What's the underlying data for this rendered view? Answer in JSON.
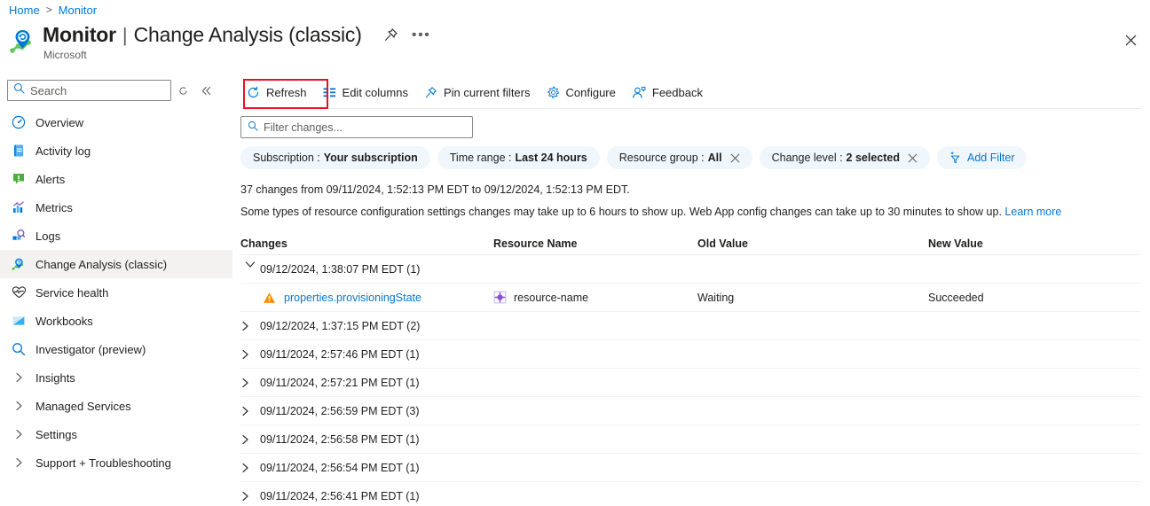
{
  "breadcrumb": {
    "home": "Home",
    "separator": ">",
    "current": "Monitor"
  },
  "header": {
    "title_strong": "Monitor",
    "title_separator": "|",
    "title_light": "Change Analysis (classic)",
    "subtitle": "Microsoft",
    "pin_icon": "pin-icon",
    "more_icon": "ellipsis-icon",
    "close_icon": "close-icon",
    "app_icon": "monitor-icon"
  },
  "sidebar": {
    "search": {
      "placeholder": "Search",
      "icon": "search-icon"
    },
    "refresh_tool_icon": "refresh-small-icon",
    "collapse_icon": "double-chevron-left-icon",
    "items": [
      {
        "label": "Overview",
        "icon": "overview-icon",
        "kind": "icon",
        "selected": false
      },
      {
        "label": "Activity log",
        "icon": "activity-log-icon",
        "kind": "icon",
        "selected": false
      },
      {
        "label": "Alerts",
        "icon": "alerts-icon",
        "kind": "icon",
        "selected": false
      },
      {
        "label": "Metrics",
        "icon": "metrics-icon",
        "kind": "icon",
        "selected": false
      },
      {
        "label": "Logs",
        "icon": "logs-icon",
        "kind": "icon",
        "selected": false
      },
      {
        "label": "Change Analysis (classic)",
        "icon": "change-analysis-icon",
        "kind": "icon",
        "selected": true
      },
      {
        "label": "Service health",
        "icon": "service-health-icon",
        "kind": "icon",
        "selected": false
      },
      {
        "label": "Workbooks",
        "icon": "workbooks-icon",
        "kind": "icon",
        "selected": false
      },
      {
        "label": "Investigator (preview)",
        "icon": "investigator-icon",
        "kind": "icon",
        "selected": false
      },
      {
        "label": "Insights",
        "icon": "chevron-right-icon",
        "kind": "chevron",
        "selected": false
      },
      {
        "label": "Managed Services",
        "icon": "chevron-right-icon",
        "kind": "chevron",
        "selected": false
      },
      {
        "label": "Settings",
        "icon": "chevron-right-icon",
        "kind": "chevron",
        "selected": false
      },
      {
        "label": "Support + Troubleshooting",
        "icon": "chevron-right-icon",
        "kind": "chevron",
        "selected": false
      }
    ]
  },
  "toolbar": {
    "refresh_label": "Refresh",
    "refresh_icon": "refresh-icon",
    "edit_columns_label": "Edit columns",
    "edit_columns_icon": "columns-icon",
    "pin_filters_label": "Pin current filters",
    "pin_filters_icon": "pin-icon",
    "configure_label": "Configure",
    "configure_icon": "gear-icon",
    "feedback_label": "Feedback",
    "feedback_icon": "feedback-person-icon",
    "highlight_color": "#e81123"
  },
  "filters": {
    "search": {
      "placeholder": "Filter changes...",
      "icon": "search-icon"
    },
    "pills": [
      {
        "label": "Subscription :",
        "value": "Your subscription",
        "dismissible": false
      },
      {
        "label": "Time range :",
        "value": "Last 24 hours",
        "dismissible": false
      },
      {
        "label": "Resource group :",
        "value": "All",
        "dismissible": true,
        "x_icon": "close-icon"
      },
      {
        "label": "Change level :",
        "value": "2 selected",
        "dismissible": true,
        "x_icon": "close-icon"
      }
    ],
    "add_filter": {
      "label": "Add Filter",
      "icon": "add-filter-funnel-icon"
    }
  },
  "info": {
    "line1": "37 changes from 09/11/2024, 1:52:13 PM EDT to 09/12/2024, 1:52:13 PM EDT.",
    "line2": "Some types of resource configuration settings changes may take up to 6 hours to show up. Web App config changes can take up to 30 minutes to show up.",
    "learn_more": "Learn more"
  },
  "table": {
    "columns": {
      "changes": "Changes",
      "resource_name": "Resource Name",
      "old_value": "Old Value",
      "new_value": "New Value"
    },
    "groups": [
      {
        "timestamp": "09/12/2024, 1:38:07 PM EDT (1)",
        "expanded": true,
        "chevron_icon": "chevron-down-icon",
        "rows": [
          {
            "change": "properties.provisioningState",
            "status_icon": "warning-triangle-icon",
            "resource_name": "resource-name",
            "resource_icon": "resource-icon",
            "old_value": "Waiting",
            "new_value": "Succeeded"
          }
        ]
      },
      {
        "timestamp": "09/12/2024, 1:37:15 PM EDT (2)",
        "expanded": false,
        "chevron_icon": "chevron-right-icon",
        "rows": []
      },
      {
        "timestamp": "09/11/2024, 2:57:46 PM EDT (1)",
        "expanded": false,
        "chevron_icon": "chevron-right-icon",
        "rows": []
      },
      {
        "timestamp": "09/11/2024, 2:57:21 PM EDT (1)",
        "expanded": false,
        "chevron_icon": "chevron-right-icon",
        "rows": []
      },
      {
        "timestamp": "09/11/2024, 2:56:59 PM EDT (3)",
        "expanded": false,
        "chevron_icon": "chevron-right-icon",
        "rows": []
      },
      {
        "timestamp": "09/11/2024, 2:56:58 PM EDT (1)",
        "expanded": false,
        "chevron_icon": "chevron-right-icon",
        "rows": []
      },
      {
        "timestamp": "09/11/2024, 2:56:54 PM EDT (1)",
        "expanded": false,
        "chevron_icon": "chevron-right-icon",
        "rows": []
      },
      {
        "timestamp": "09/11/2024, 2:56:41 PM EDT (1)",
        "expanded": false,
        "chevron_icon": "chevron-right-icon",
        "rows": []
      }
    ]
  },
  "colors": {
    "accent": "#0078d4",
    "link": "#0078d4",
    "pill_bg": "#eff6fc",
    "selected_bg": "#f3f2f1",
    "warning": "#ff8c00",
    "highlight_red": "#e81123",
    "resource_purple": "#7a49c4"
  }
}
